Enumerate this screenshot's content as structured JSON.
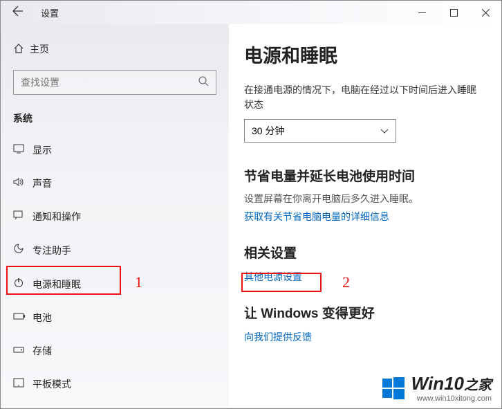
{
  "titlebar": {
    "title": "设置"
  },
  "sidebar": {
    "home": "主页",
    "search_placeholder": "查找设置",
    "category": "系统",
    "items": [
      {
        "icon": "display",
        "label": "显示"
      },
      {
        "icon": "sound",
        "label": "声音"
      },
      {
        "icon": "notifications",
        "label": "通知和操作"
      },
      {
        "icon": "focus",
        "label": "专注助手"
      },
      {
        "icon": "power",
        "label": "电源和睡眠"
      },
      {
        "icon": "battery",
        "label": "电池"
      },
      {
        "icon": "storage",
        "label": "存储"
      },
      {
        "icon": "tablet",
        "label": "平板模式"
      }
    ]
  },
  "content": {
    "heading": "电源和睡眠",
    "plugged_desc": "在接通电源的情况下，电脑在经过以下时间后进入睡眠状态",
    "sleep_value": "30 分钟",
    "save_heading": "节省电量并延长电池使用时间",
    "save_desc": "设置屏幕在你离开电脑后多久进入睡眠。",
    "save_link": "获取有关节省电脑电量的详细信息",
    "related_heading": "相关设置",
    "related_link": "其他电源设置",
    "better_heading": "让 Windows 变得更好",
    "feedback_link": "向我们提供反馈"
  },
  "markers": {
    "one": "1",
    "two": "2"
  },
  "watermark": {
    "main": "Win10",
    "zh": "之家",
    "url": "www.win10xitong.com"
  }
}
